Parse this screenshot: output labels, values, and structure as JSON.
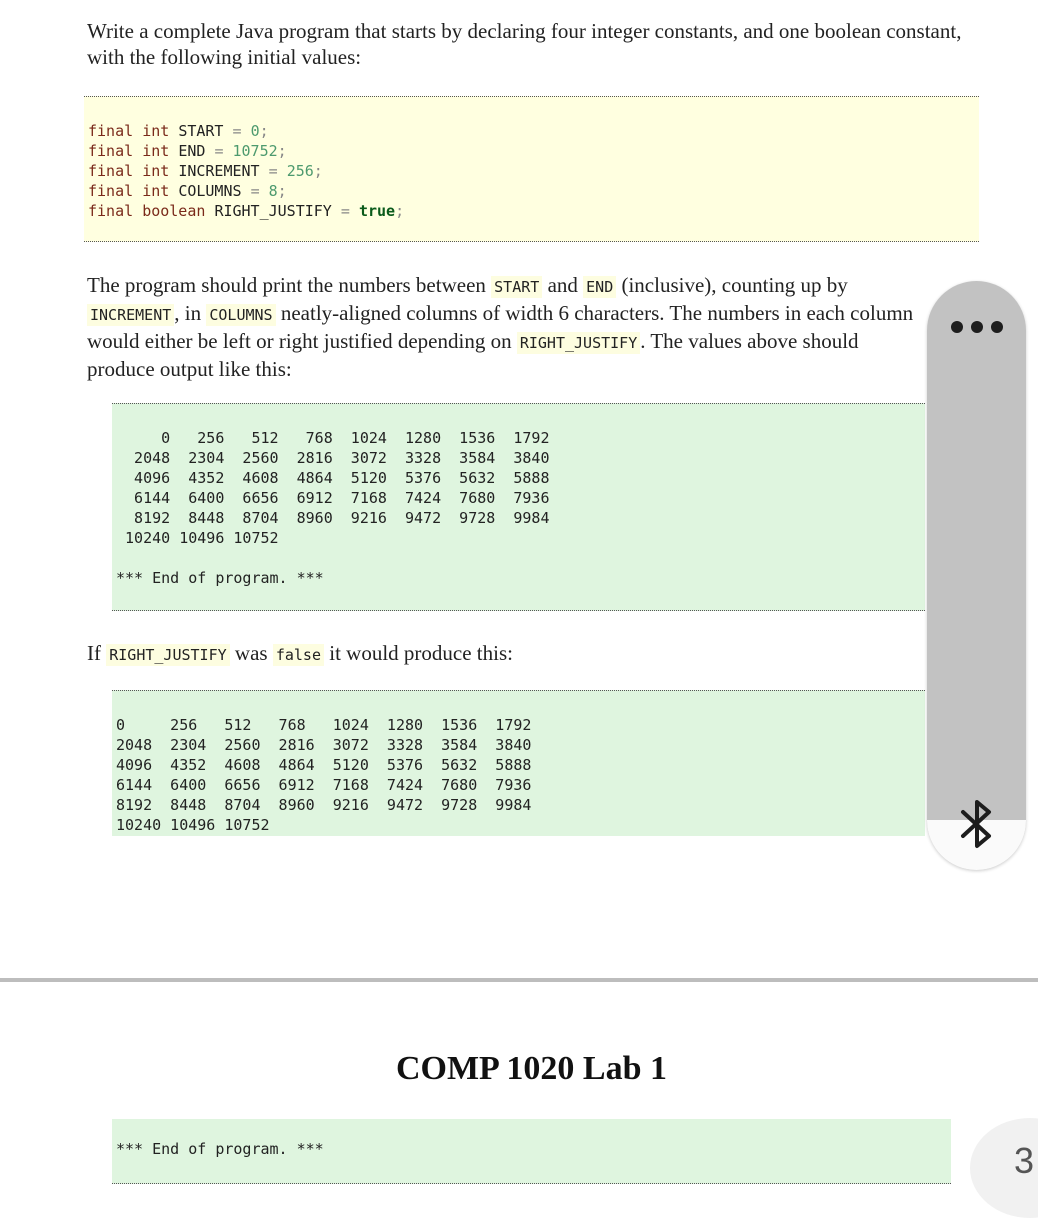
{
  "intro": {
    "text": "Write a complete Java program that starts by declaring four integer constants, and one boolean constant, with the following initial values:"
  },
  "constants": [
    {
      "modifier": "final",
      "type": "int",
      "name": "START",
      "eq": "=",
      "value": "0",
      "end": ";"
    },
    {
      "modifier": "final",
      "type": "int",
      "name": "END",
      "eq": "=",
      "value": "10752",
      "end": ";"
    },
    {
      "modifier": "final",
      "type": "int",
      "name": "INCREMENT",
      "eq": "=",
      "value": "256",
      "end": ";"
    },
    {
      "modifier": "final",
      "type": "int",
      "name": "COLUMNS",
      "eq": "=",
      "value": "8",
      "end": ";"
    },
    {
      "modifier": "final",
      "type": "boolean",
      "name": "RIGHT_JUSTIFY",
      "eq": "=",
      "value": "true",
      "end": ";"
    }
  ],
  "description": {
    "t1": "The program should print the numbers between ",
    "c1": "START",
    "t2": " and ",
    "c2": "END",
    "t3": " (inclusive), counting up by ",
    "c3": "INCREMENT",
    "t4": ", in ",
    "c4": "COLUMNS",
    "t5": " neatly-aligned columns of width 6 characters. The numbers in each column would either be left or right justified depending on ",
    "c5": "RIGHT_JUSTIFY",
    "t6": ". The values above should produce output like this:"
  },
  "output_right": {
    "lines": [
      "     0   256   512   768  1024  1280  1536  1792",
      "  2048  2304  2560  2816  3072  3328  3584  3840",
      "  4096  4352  4608  4864  5120  5376  5632  5888",
      "  6144  6400  6656  6912  7168  7424  7680  7936",
      "  8192  8448  8704  8960  9216  9472  9728  9984",
      " 10240 10496 10752",
      "",
      "*** End of program. ***"
    ]
  },
  "false_note": {
    "t1": "If ",
    "c1": "RIGHT_JUSTIFY",
    "t2": " was ",
    "c2": "false",
    "t3": " it would produce this:"
  },
  "output_left": {
    "lines": [
      "0     256   512   768   1024  1280  1536  1792",
      "2048  2304  2560  2816  3072  3328  3584  3840",
      "4096  4352  4608  4864  5120  5376  5632  5888",
      "6144  6400  6656  6912  7168  7424  7680  7936",
      "8192  8448  8704  8960  9216  9472  9728  9984",
      "10240 10496 10752"
    ]
  },
  "next_page": {
    "title": "COMP 1020 Lab 1",
    "output_line": "*** End of program. ***"
  },
  "overlay": {
    "more_icon": "more-horizontal-icon",
    "bluetooth_icon": "bluetooth-icon",
    "page_number": "3"
  }
}
